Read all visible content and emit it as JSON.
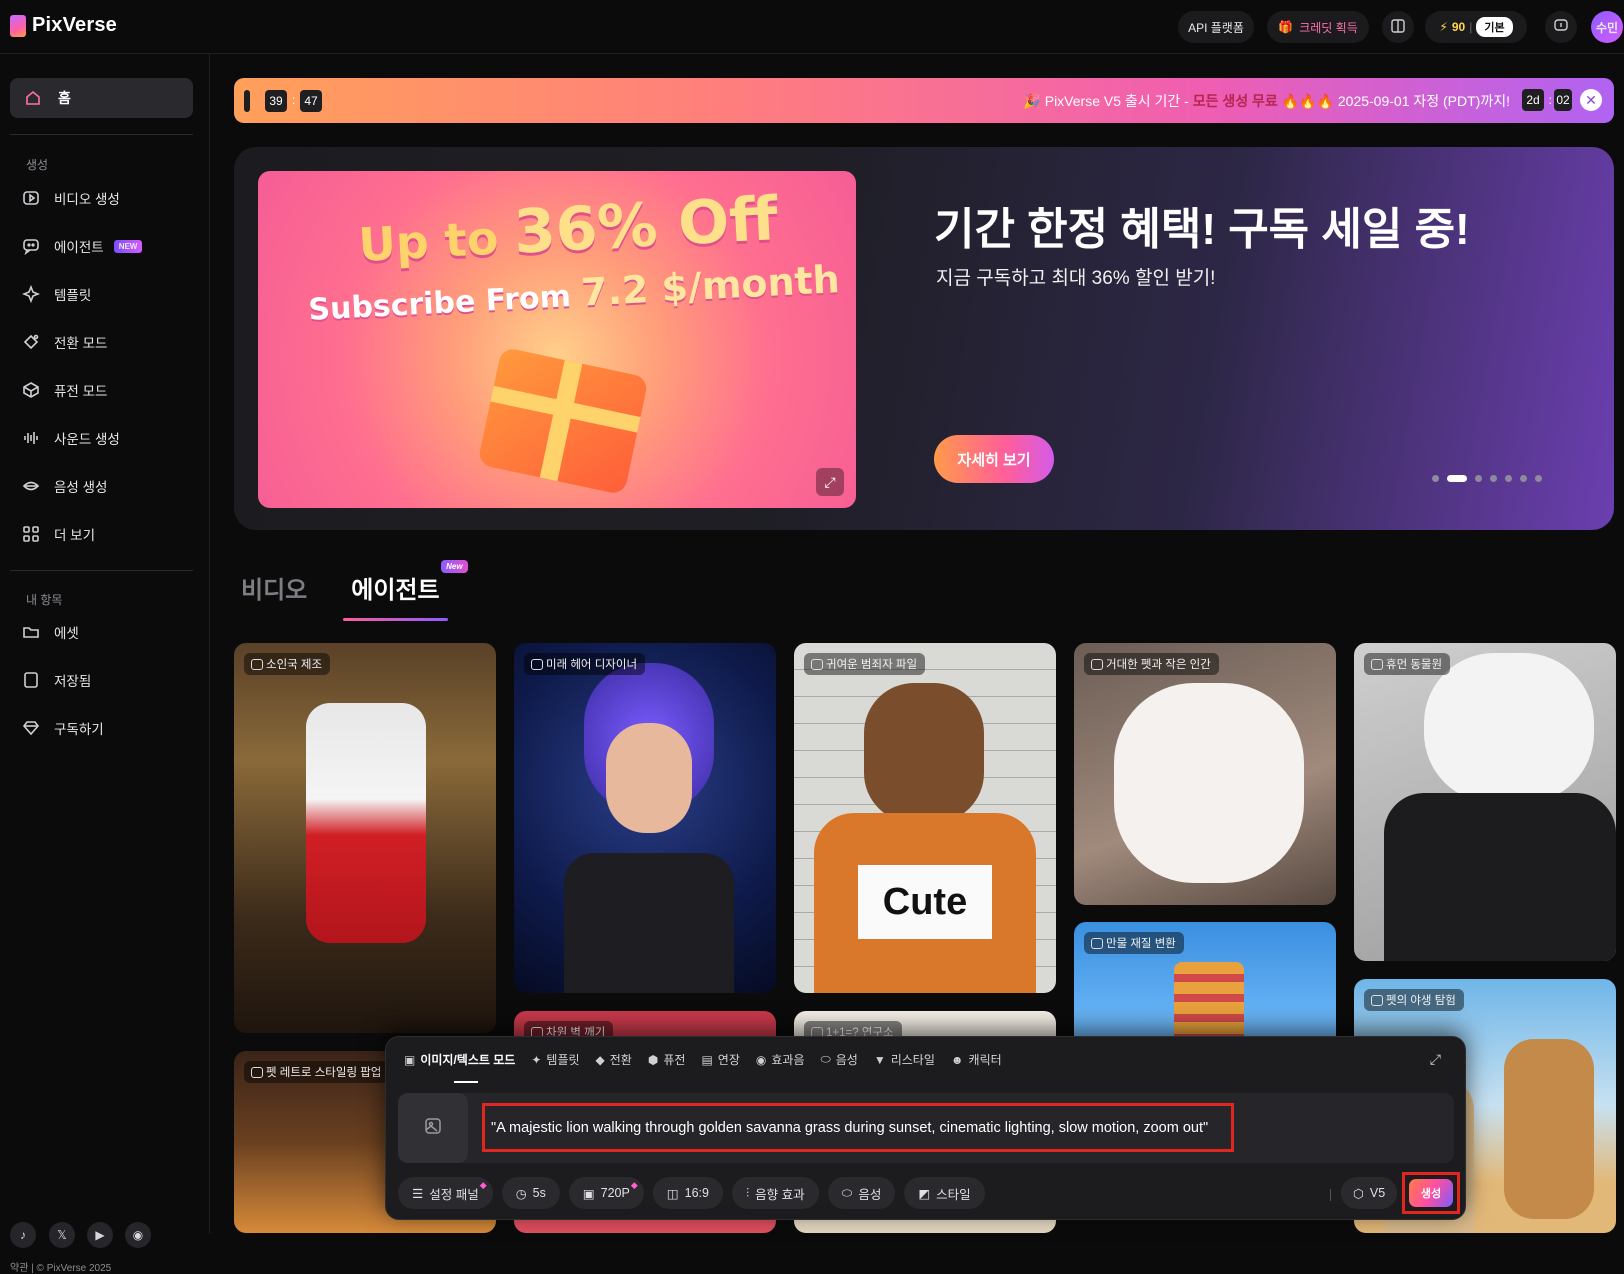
{
  "brand": {
    "name": "PixVerse"
  },
  "header": {
    "api": "API 플랫폼",
    "credit": "크레딧 획득",
    "credits_value": "90",
    "plan": "기본",
    "avatar": "수민"
  },
  "sidebar": {
    "home": "홈",
    "section_create": "생성",
    "create_items": [
      {
        "label": "비디오 생성",
        "icon": "video-plus-icon"
      },
      {
        "label": "에이전트",
        "icon": "chat-bot-icon",
        "badge": "NEW"
      },
      {
        "label": "템플릿",
        "icon": "sparkle-icon"
      },
      {
        "label": "전환 모드",
        "icon": "transition-icon"
      },
      {
        "label": "퓨전 모드",
        "icon": "cube-icon"
      },
      {
        "label": "사운드 생성",
        "icon": "waveform-icon"
      },
      {
        "label": "음성 생성",
        "icon": "lips-icon"
      },
      {
        "label": "더 보기",
        "icon": "grid-icon"
      }
    ],
    "section_mine": "내 항목",
    "mine_items": [
      {
        "label": "에셋",
        "icon": "folder-icon"
      },
      {
        "label": "저장됨",
        "icon": "bookmark-icon"
      },
      {
        "label": "구독하기",
        "icon": "diamond-icon"
      }
    ],
    "legal": "약관 | © PixVerse 2025"
  },
  "promo": {
    "counter_a": "39",
    "counter_b": "47",
    "text_prefix": "🎉 PixVerse V5 출시 기간 - ",
    "text_highlight": "모든 생성 무료",
    "text_suffix": " 🔥🔥🔥 2025-09-01 자정 (PDT)까지!",
    "days": "2d",
    "hours": "02"
  },
  "hero": {
    "img_line1_a": "Up to ",
    "img_line1_b": "36% Off",
    "img_line2_a": "Subscribe From ",
    "img_line2_b": "7.2 $/month",
    "title": "기간 한정 혜택! 구독 세일 중!",
    "subtitle": "지금 구독하고 최대 36% 할인 받기!",
    "cta": "자세히 보기",
    "slide_count": 7,
    "active_slide": 2
  },
  "content_tabs": {
    "video": "비디오",
    "agent": "에이전트",
    "agent_badge": "New"
  },
  "cards": [
    {
      "label": "소인국 제조"
    },
    {
      "label": "미래 헤어 디자이너"
    },
    {
      "label": "귀여운 범죄자 파일"
    },
    {
      "label": "거대한 펫과 작은 인간"
    },
    {
      "label": "휴먼 동물원"
    },
    {
      "label": "만물 재질 변환"
    },
    {
      "label": "펫의 야생 탐험"
    },
    {
      "label": "펫 레트로 스타일링 팝업"
    },
    {
      "label": "차원 벽 깨기"
    },
    {
      "label": "1+1=? 연구소"
    }
  ],
  "cute_sign": "Cute",
  "composer": {
    "modes": [
      {
        "label": "이미지/텍스트 모드",
        "icon": "image-icon"
      },
      {
        "label": "템플릿",
        "icon": "sparkle-icon"
      },
      {
        "label": "전환",
        "icon": "transition-icon"
      },
      {
        "label": "퓨전",
        "icon": "cube-icon"
      },
      {
        "label": "연장",
        "icon": "extend-icon"
      },
      {
        "label": "효과음",
        "icon": "sound-icon"
      },
      {
        "label": "음성",
        "icon": "lips-icon"
      },
      {
        "label": "리스타일",
        "icon": "brush-icon"
      },
      {
        "label": "캐릭터",
        "icon": "face-icon"
      }
    ],
    "prompt": "\"A majestic lion walking through golden savanna grass during sunset, cinematic lighting, slow motion, zoom out\"",
    "controls": {
      "settings": "설정 패널",
      "duration": "5s",
      "quality": "720P",
      "ratio": "16:9",
      "sfx": "음향 효과",
      "voice": "음성",
      "style": "스타일"
    },
    "model": "V5",
    "generate": "생성"
  },
  "colors": {
    "accent_pink": "#ff5e9a",
    "accent_purple": "#8c5cff",
    "highlight_box": "#e0261f"
  }
}
